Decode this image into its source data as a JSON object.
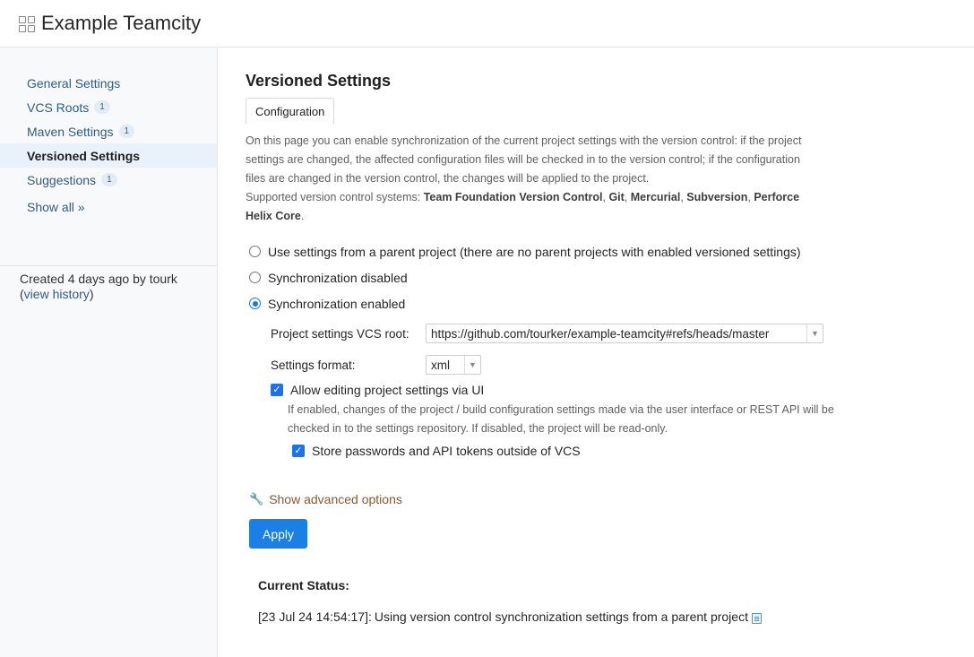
{
  "header": {
    "title": "Example Teamcity",
    "icon": "grid-icon"
  },
  "sidebar": {
    "items": [
      {
        "label": "General Settings",
        "badge": null
      },
      {
        "label": "VCS Roots",
        "badge": "1"
      },
      {
        "label": "Maven Settings",
        "badge": "1"
      },
      {
        "label": "Versioned Settings",
        "badge": null,
        "active": true
      },
      {
        "label": "Suggestions",
        "badge": "1"
      }
    ],
    "show_all": "Show all »",
    "created_prefix": "Created 4 days ago by tourk",
    "view_history": "view history"
  },
  "main": {
    "title": "Versioned Settings",
    "tab": "Configuration",
    "description": {
      "text": "On this page you can enable synchronization of the current project settings with the version control: if the project settings are changed, the affected configuration files will be checked in to the version control; if the configuration files are changed in the version control, the changes will be applied to the project.",
      "supported_prefix": "Supported version control systems: ",
      "systems": [
        "Team Foundation Version Control",
        "Git",
        "Mercurial",
        "Subversion",
        "Perforce Helix Core"
      ]
    },
    "radios": [
      {
        "label": "Use settings from a parent project (there are no parent projects with enabled versioned settings)",
        "checked": false
      },
      {
        "label": "Synchronization disabled",
        "checked": false
      },
      {
        "label": "Synchronization enabled",
        "checked": true
      }
    ],
    "vcs_root": {
      "label": "Project settings VCS root:",
      "value": "https://github.com/tourker/example-teamcity#refs/heads/master"
    },
    "format": {
      "label": "Settings format:",
      "value": "xml"
    },
    "allow_editing": {
      "label": "Allow editing project settings via UI",
      "checked": true,
      "hint": "If enabled, changes of the project / build configuration settings made via the user interface or REST API will be checked in to the settings repository. If disabled, the project will be read-only."
    },
    "store_passwords": {
      "label": "Store passwords and API tokens outside of VCS",
      "checked": true
    },
    "advanced": "Show advanced options",
    "apply": "Apply",
    "status": {
      "title": "Current Status:",
      "timestamp": "[23 Jul 24 14:54:17]:",
      "message": "Using version control synchronization settings from a parent project"
    }
  },
  "colors": {
    "accent": "#1a80e5",
    "link": "#2f5b8a",
    "advanced_link": "#8a5a2b"
  }
}
